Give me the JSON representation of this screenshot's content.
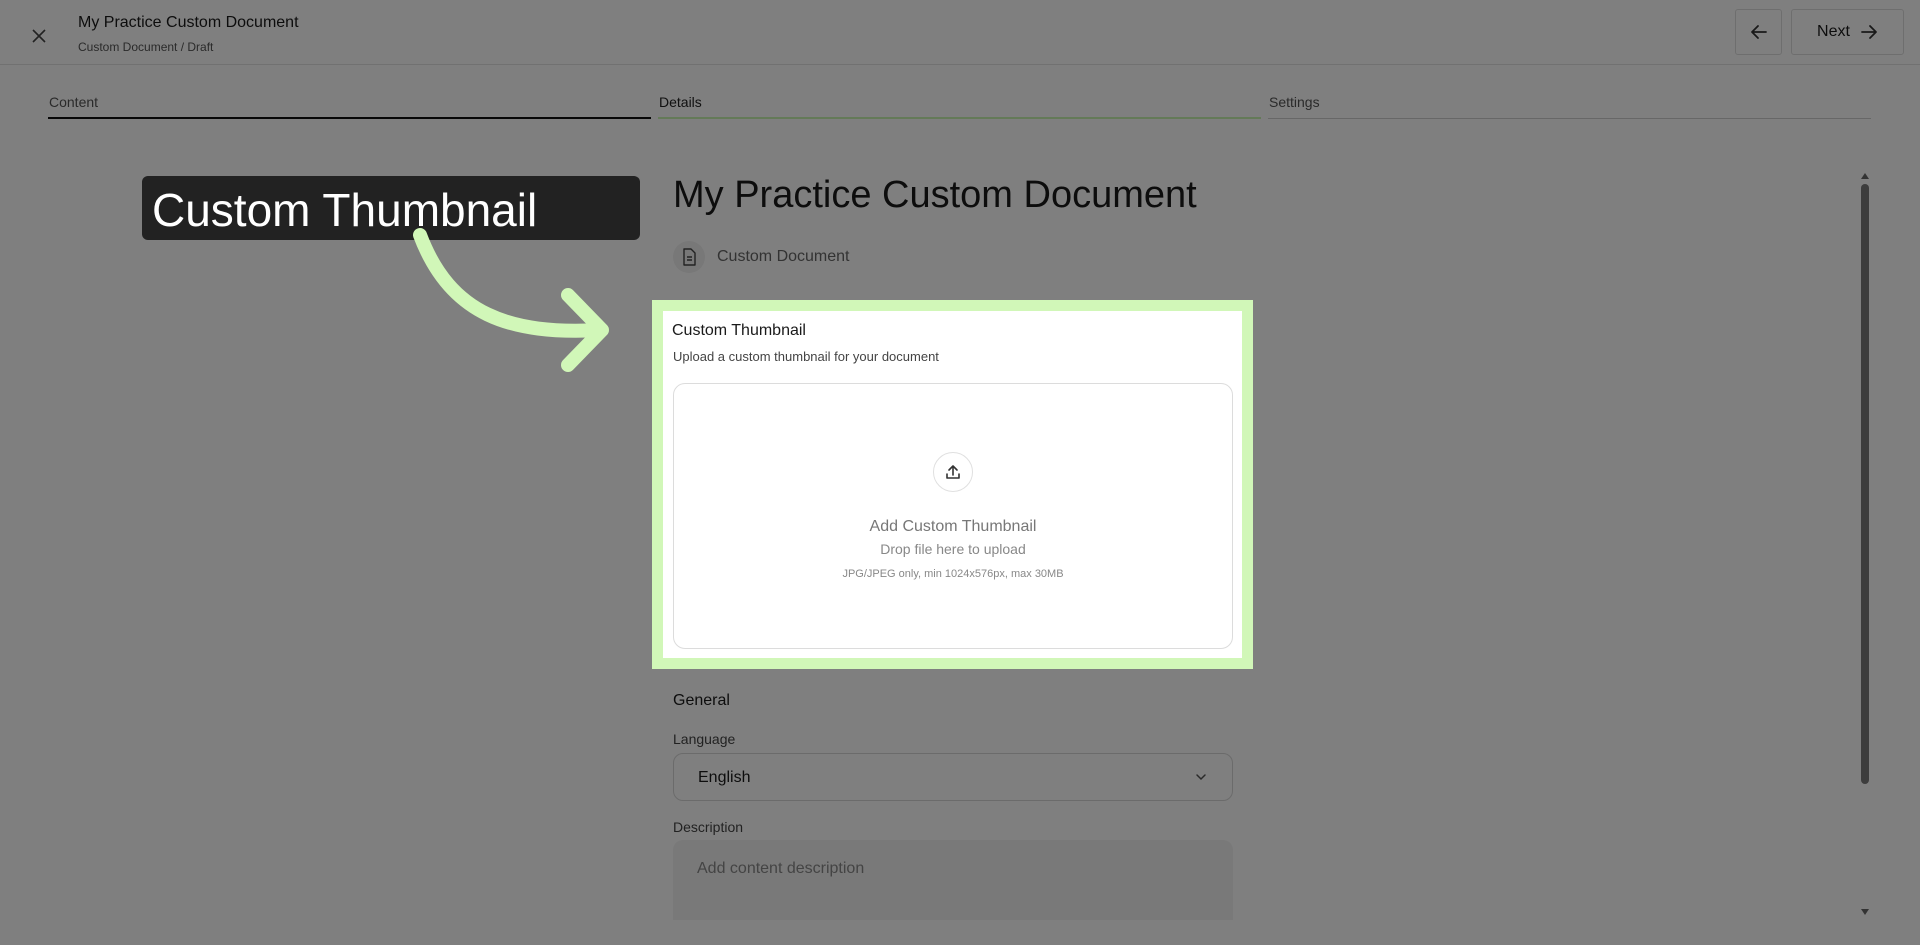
{
  "header": {
    "title": "My Practice Custom Document",
    "breadcrumb": "Custom Document / Draft",
    "next_label": "Next"
  },
  "steps": [
    {
      "label": "Content"
    },
    {
      "label": "Details"
    },
    {
      "label": "Settings"
    }
  ],
  "main": {
    "title": "My Practice Custom Document",
    "content_type": "Custom Document"
  },
  "thumbnail": {
    "heading": "Custom Thumbnail",
    "description": "Upload a custom thumbnail for your document",
    "drop_title": "Add Custom Thumbnail",
    "drop_sub": "Drop file here to upload",
    "drop_hint": "JPG/JPEG only, min 1024x576px, max 30MB"
  },
  "general": {
    "heading": "General",
    "language_label": "Language",
    "language_value": "English",
    "description_label": "Description",
    "description_placeholder": "Add content description"
  },
  "overlay": {
    "callout_text": "Custom Thumbnail",
    "highlight_color": "#d1f7b8"
  },
  "icons": {
    "close": "close-icon",
    "back": "arrow-left-icon",
    "next": "arrow-right-icon",
    "document": "document-icon",
    "upload": "upload-icon",
    "chevron": "chevron-down-icon"
  }
}
